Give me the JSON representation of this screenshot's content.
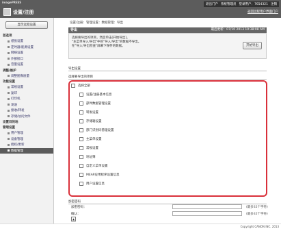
{
  "header": {
    "brand": "imagePRESS",
    "app_title": "设置/注册",
    "user_bar": [
      "退出门户",
      "系统管理员",
      "登录用户：7654321",
      "注销"
    ],
    "portal_link": "返回远程用户界面门户"
  },
  "sidebar": {
    "top_button": "显示远程设置",
    "sections": [
      {
        "title": "首选项",
        "items": [
          "纸张设置",
          "定时器/能源设置",
          "网络设置",
          "外部接口",
          "音量设置"
        ]
      },
      {
        "title": "调整/维护",
        "items": [
          "调整图像质量"
        ]
      },
      {
        "title": "功能设置",
        "items": [
          "常规设置",
          "复印",
          "打印机",
          "发送",
          "接收/转发",
          "存储/访问文件"
        ]
      },
      {
        "title": "设置目的地",
        "items": []
      },
      {
        "title": "管理设置",
        "items": [
          "用户管理",
          "设备管理",
          "授权/更新",
          "数据管理"
        ]
      }
    ],
    "active_item": "数据管理"
  },
  "breadcrumb": "设置/注册：管理设置：数据管理：导出",
  "panel": {
    "title": "导出",
    "timestamp_label": "最后更新：07/10 2013 10:38:08 AM",
    "description": [
      "选择要导出的项目，然后单击[开始导出]。",
      "\"主菜单导入/导出\"中的\"导入/导出\"的数据不导出。",
      "在\"导入/导出检查\"屏幕下保存的数据。"
    ],
    "start_button": "开始导出"
  },
  "export_settings": {
    "section_title": "导出设置",
    "items_title": "选择要导出的项目",
    "select_all": "选择全部",
    "items": [
      "设置/注册基本信息",
      "部件数据管理设置",
      "转发设置",
      "存储箱设置",
      "部门识别码管理设置",
      "主菜单设置",
      "常规设置",
      "地址簿",
      "自定义菜单设置",
      "MEAP应用程序设置信息",
      "用户设置信息"
    ]
  },
  "encryption": {
    "title": "加密密码",
    "password_label": "加密密码：",
    "confirm_label": "确认：",
    "hint": "(最多32个字符)"
  },
  "footer": {
    "copyright": "Copyright CANON INC. 2013"
  }
}
